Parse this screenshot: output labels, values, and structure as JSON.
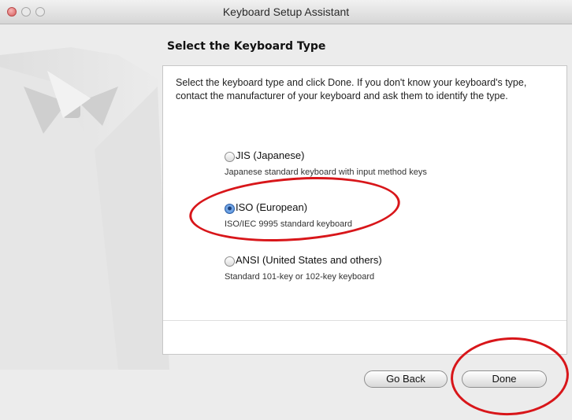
{
  "window": {
    "title": "Keyboard Setup Assistant"
  },
  "pane": {
    "title": "Select the Keyboard Type",
    "instructions": "Select the keyboard type and click Done. If you don't know your keyboard's type, contact the manufacturer of your keyboard and ask them to identify the type."
  },
  "options": [
    {
      "label": "JIS (Japanese)",
      "description": "Japanese standard keyboard with input method keys",
      "selected": false
    },
    {
      "label": "ISO (European)",
      "description": "ISO/IEC 9995 standard keyboard",
      "selected": true
    },
    {
      "label": "ANSI (United States and others)",
      "description": "Standard 101-key or 102-key keyboard",
      "selected": false
    }
  ],
  "buttons": {
    "go_back": "Go Back",
    "done": "Done"
  },
  "colors": {
    "annotation": "#d8161a",
    "radio_selected": "#3f7fd0",
    "panel": "#ffffff",
    "window": "#ececec"
  }
}
